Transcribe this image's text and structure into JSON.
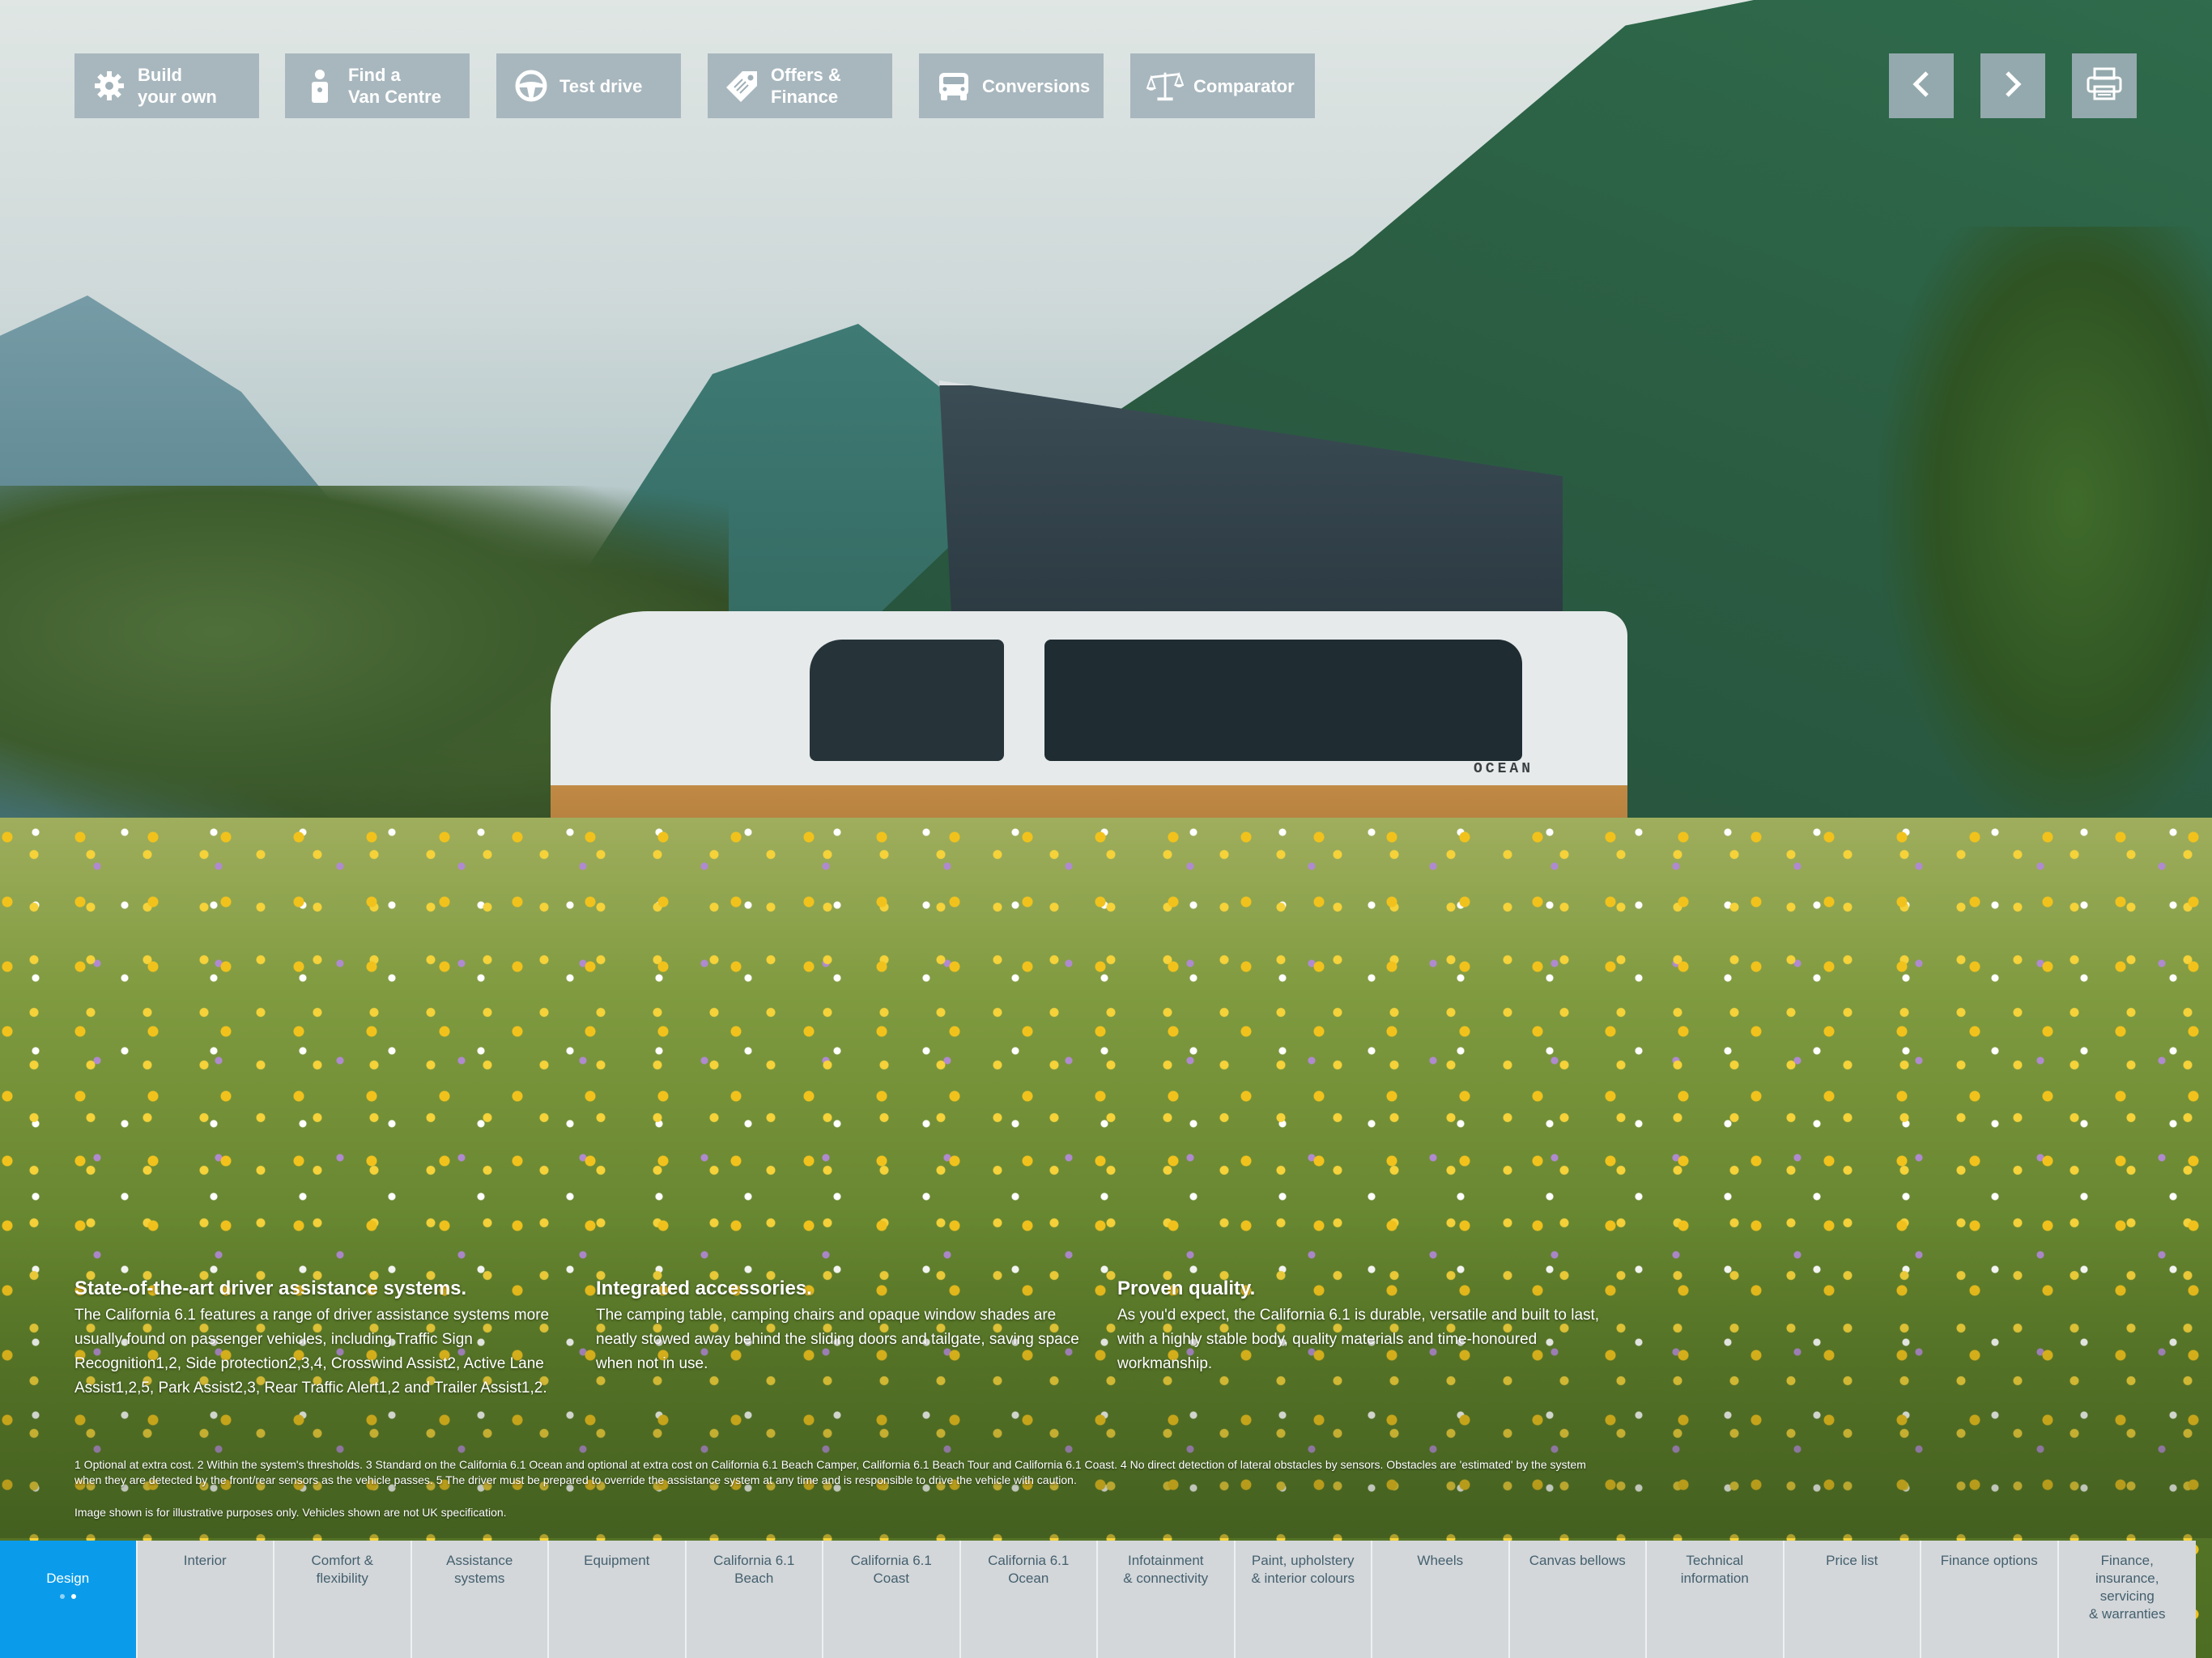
{
  "toolbar": {
    "buttons": [
      {
        "label": "Build\nyour own",
        "icon": "gear-icon"
      },
      {
        "label": "Find a\nVan Centre",
        "icon": "person-icon"
      },
      {
        "label": "Test drive",
        "icon": "steering-wheel-icon"
      },
      {
        "label": "Offers &\nFinance",
        "icon": "price-tag-icon"
      },
      {
        "label": "Conversions",
        "icon": "van-icon"
      },
      {
        "label": "Comparator",
        "icon": "scales-icon"
      }
    ],
    "prev_icon": "chevron-left-icon",
    "next_icon": "chevron-right-icon",
    "print_icon": "printer-icon"
  },
  "vehicle_badge": "OCEAN",
  "columns": [
    {
      "title": "State-of-the-art driver assistance systems.",
      "body": "The California 6.1 features a range of driver assistance systems more usually found on passenger vehicles, including Traffic Sign Recognition1,2, Side protection2,3,4, Crosswind Assist2, Active Lane Assist1,2,5, Park Assist2,3, Rear Traffic Alert1,2 and Trailer Assist1,2."
    },
    {
      "title": "Integrated accessories.",
      "body": "The camping table, camping chairs and opaque window shades are neatly stowed away behind the sliding doors and tailgate, saving space when not in use."
    },
    {
      "title": "Proven quality.",
      "body": "As you'd expect, the California 6.1 is durable, versatile and built to last, with a highly stable body, quality materials and time-honoured workmanship."
    }
  ],
  "footnotes": "1 Optional at extra cost.    2 Within the system's thresholds.    3 Standard on the California 6.1 Ocean and optional at extra cost on California 6.1 Beach Camper, California 6.1 Beach Tour and California 6.1 Coast.    4 No direct detection of lateral obstacles by sensors. Obstacles are 'estimated' by the system when they are detected by the front/rear sensors as the vehicle passes.    5 The driver must be prepared to override the assistance system at any time and is responsible to drive the vehicle with caution.",
  "disclaimer": "Image shown is for illustrative purposes only. Vehicles shown are not UK specification.",
  "bottom_nav": [
    {
      "label": "Design",
      "active": true
    },
    {
      "label": "Interior"
    },
    {
      "label": "Comfort &\nflexibility"
    },
    {
      "label": "Assistance\nsystems"
    },
    {
      "label": "Equipment"
    },
    {
      "label": "California 6.1\nBeach"
    },
    {
      "label": "California 6.1\nCoast"
    },
    {
      "label": "California 6.1\nOcean"
    },
    {
      "label": "Infotainment\n& connectivity"
    },
    {
      "label": "Paint, upholstery\n& interior colours"
    },
    {
      "label": "Wheels"
    },
    {
      "label": "Canvas bellows"
    },
    {
      "label": "Technical\ninformation"
    },
    {
      "label": "Price list"
    },
    {
      "label": "Finance options"
    },
    {
      "label": "Finance,\ninsurance,\nservicing\n& warranties"
    }
  ],
  "design_pages": {
    "count": 2,
    "current": 2
  },
  "colors": {
    "accent": "#0a9cea",
    "button_bg": "#a0b0b8",
    "nav_bg": "#d3d7da",
    "nav_text": "#45606e"
  }
}
